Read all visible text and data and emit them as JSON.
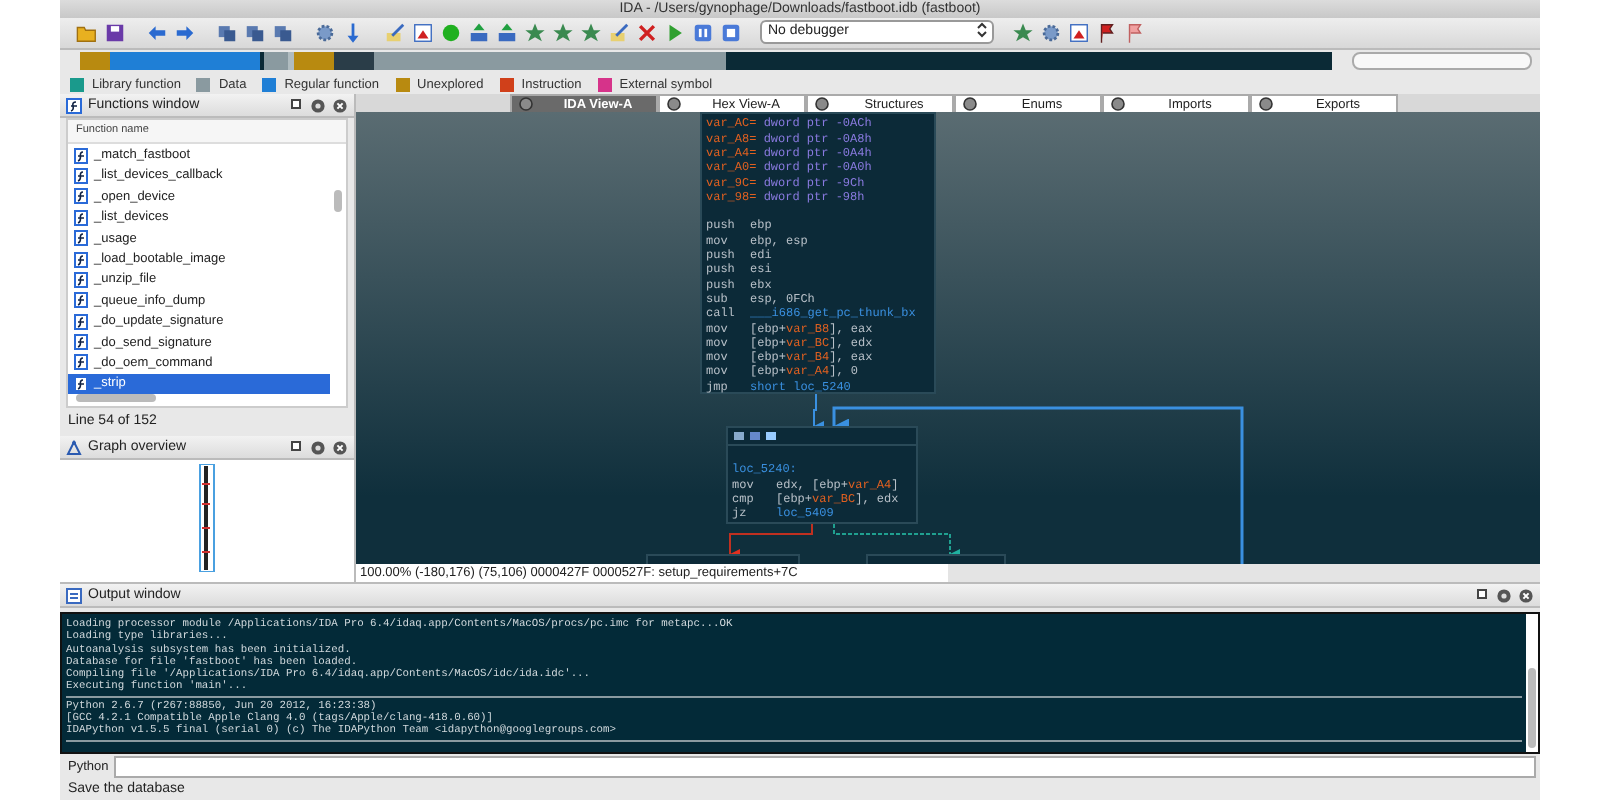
{
  "window": {
    "title": "IDA - /Users/gynophage/Downloads/fastboot.idb (fastboot)"
  },
  "toolbar": {
    "debugger": "No debugger"
  },
  "legend": [
    {
      "label": "Library function",
      "color": "#1a9a8c"
    },
    {
      "label": "Data",
      "color": "#8a9aa0"
    },
    {
      "label": "Regular function",
      "color": "#1f7fd6"
    },
    {
      "label": "Unexplored",
      "color": "#b88a10"
    },
    {
      "label": "Instruction",
      "color": "#d0401a"
    },
    {
      "label": "External symbol",
      "color": "#d6338a"
    }
  ],
  "functions_window": {
    "title": "Functions window",
    "column": "Function name",
    "items": [
      {
        "name": "_match_fastboot",
        "selected": false
      },
      {
        "name": "_list_devices_callback",
        "selected": false
      },
      {
        "name": "_open_device",
        "selected": false
      },
      {
        "name": "_list_devices",
        "selected": false
      },
      {
        "name": "_usage",
        "selected": false
      },
      {
        "name": "_load_bootable_image",
        "selected": false
      },
      {
        "name": "_unzip_file",
        "selected": false
      },
      {
        "name": "_queue_info_dump",
        "selected": false
      },
      {
        "name": "_do_update_signature",
        "selected": false
      },
      {
        "name": "_do_send_signature",
        "selected": false
      },
      {
        "name": "_do_oem_command",
        "selected": false
      },
      {
        "name": "_strip",
        "selected": true
      }
    ],
    "status": "Line 54 of 152"
  },
  "graph_overview": {
    "title": "Graph overview"
  },
  "tabs": [
    {
      "label": "IDA View-A",
      "selected": true
    },
    {
      "label": "Hex View-A",
      "selected": false
    },
    {
      "label": "Structures",
      "selected": false
    },
    {
      "label": "Enums",
      "selected": false
    },
    {
      "label": "Imports",
      "selected": false
    },
    {
      "label": "Exports",
      "selected": false
    }
  ],
  "graph": {
    "nodes": [
      {
        "vars": [
          {
            "name": "var_AC=",
            "value": "dword ptr -0ACh"
          },
          {
            "name": "var_A8=",
            "value": "dword ptr -0A8h"
          },
          {
            "name": "var_A4=",
            "value": "dword ptr -0A4h"
          },
          {
            "name": "var_A0=",
            "value": "dword ptr -0A0h"
          },
          {
            "name": "var_9C=",
            "value": "dword ptr -9Ch"
          },
          {
            "name": "var_98=",
            "value": "dword ptr -98h"
          }
        ],
        "lines": [
          {
            "mnemonic": "push",
            "operand": "ebp"
          },
          {
            "mnemonic": "mov",
            "operand": "ebp, esp"
          },
          {
            "mnemonic": "push",
            "operand": "edi"
          },
          {
            "mnemonic": "push",
            "operand": "esi"
          },
          {
            "mnemonic": "push",
            "operand": "ebx"
          },
          {
            "mnemonic": "sub",
            "operand": "esp, 0FCh"
          },
          {
            "mnemonic": "call",
            "operand": "*___i686_get_pc_thunk_bx*"
          },
          {
            "mnemonic": "mov",
            "operand": "[ebp+**var_B8**], eax"
          },
          {
            "mnemonic": "mov",
            "operand": "[ebp+**var_BC**], edx"
          },
          {
            "mnemonic": "mov",
            "operand": "[ebp+**var_B4**], eax"
          },
          {
            "mnemonic": "mov",
            "operand": "[ebp+**var_A4**], 0"
          },
          {
            "mnemonic": "jmp",
            "operand": "*short loc_5240*"
          }
        ]
      },
      {
        "label": "loc_5240:",
        "lines": [
          {
            "mnemonic": "mov",
            "operand": "edx, [ebp+**var_A4**]"
          },
          {
            "mnemonic": "cmp",
            "operand": "[ebp+**var_BC**], edx"
          },
          {
            "mnemonic": "jz",
            "operand": "*loc_5409*"
          }
        ]
      }
    ],
    "status": "100.00% (-180,176) (75,106) 0000427F 0000527F: setup_requirements+7C"
  },
  "output": {
    "title": "Output window",
    "groups": [
      [
        "Loading processor module /Applications/IDA Pro 6.4/idaq.app/Contents/MacOS/procs/pc.imc for metapc...OK",
        "Loading type libraries...",
        "Autoanalysis subsystem has been initialized.",
        "Database for file 'fastboot' has been loaded.",
        "Compiling file '/Applications/IDA Pro 6.4/idaq.app/Contents/MacOS/idc/ida.idc'...",
        "Executing function 'main'..."
      ],
      [
        "Python 2.6.7 (r267:88850, Jun 20 2012, 16:23:38)",
        "[GCC 4.2.1 Compatible Apple Clang 4.0 (tags/Apple/clang-418.0.60)]",
        "IDAPython v1.5.5 final (serial 0) (c) The IDAPython Team <idapython@googlegroups.com>"
      ]
    ]
  },
  "python": {
    "label": "Python"
  },
  "status_bar": "Save the database"
}
